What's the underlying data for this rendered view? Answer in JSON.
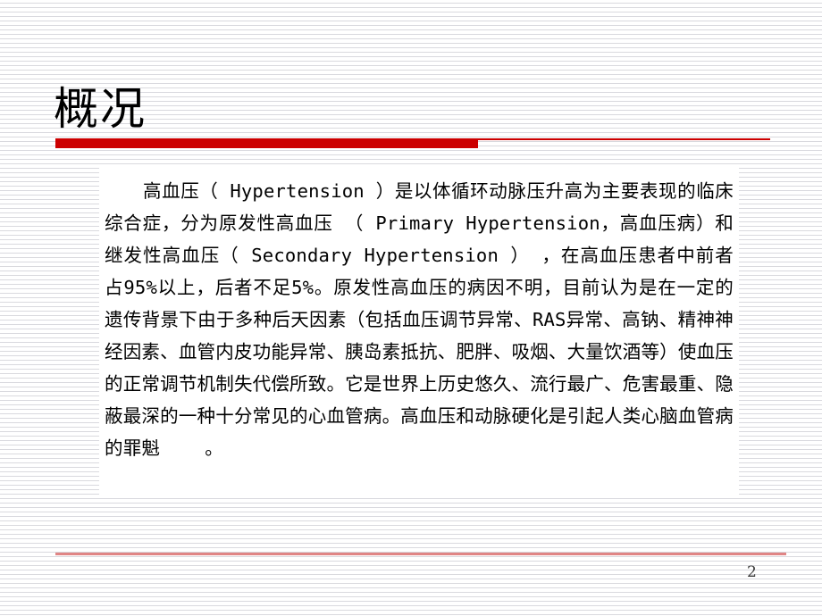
{
  "slide": {
    "title": "概况",
    "page_number": "2",
    "body_text": "高血压（ Hypertension ）是以体循环动脉压升高为主要表现的临床综合症，分为原发性高血压 （ Primary Hypertension，高血压病）和继发性高血压（ Secondary Hypertension ） ，在高血压患者中前者占95%以上，后者不足5%。原发性高血压的病因不明，目前认为是在一定的遗传背景下由于多种后天因素（包括血压调节异常、RAS异常、高钠、精神神经因素、血管内皮功能异常、胰岛素抵抗、肥胖、吸烟、大量饮酒等）使血压的正常调节机制失代偿所致。它是世界上历史悠久、流行最广、危害最重、隐蔽最深的一种十分常见的心血管病。高血压和动脉硬化是引起人类心脑血管病的罪魁    。"
  },
  "theme": {
    "accent_red": "#CC0000",
    "footer_line": "#E08585",
    "texture_line": "#D9D9DE",
    "background": "#FFFFFF",
    "text_color": "#000000"
  }
}
